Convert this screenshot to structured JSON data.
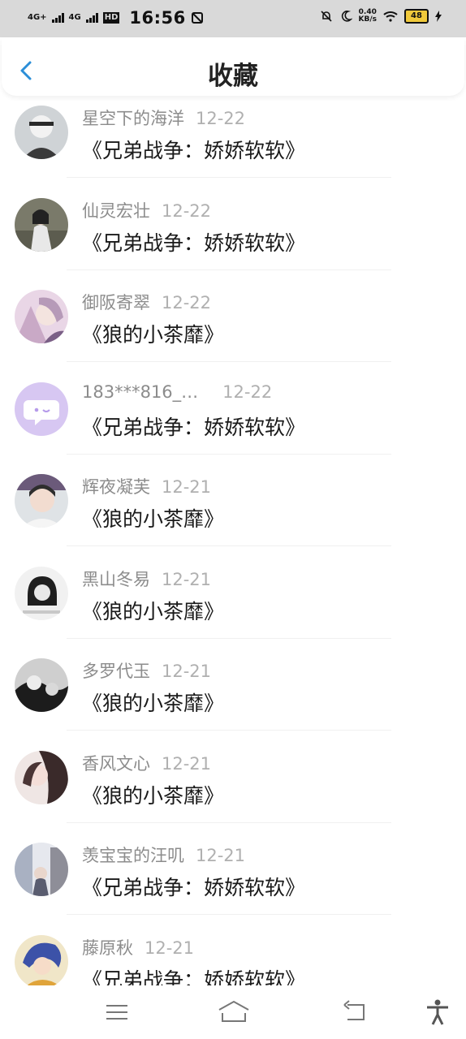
{
  "status_bar": {
    "network1": "4G+",
    "network2": "4G",
    "hd": "HD",
    "time": "16:56",
    "speed_value": "0.40",
    "speed_unit": "KB/s",
    "battery": "48"
  },
  "header": {
    "title": "收藏"
  },
  "items": [
    {
      "username": "星空下的海洋",
      "date": "12-22",
      "message": "《兄弟战争：娇娇软软》"
    },
    {
      "username": "仙灵宏壮",
      "date": "12-22",
      "message": "《兄弟战争：娇娇软软》"
    },
    {
      "username": "御阪寄翠",
      "date": "12-22",
      "message": "《狼的小茶靡》"
    },
    {
      "username": "183***816_…",
      "date": "12-22",
      "message": "《兄弟战争：娇娇软软》"
    },
    {
      "username": "辉夜凝芙",
      "date": "12-21",
      "message": "《狼的小茶靡》"
    },
    {
      "username": "黑山冬易",
      "date": "12-21",
      "message": "《狼的小茶靡》"
    },
    {
      "username": "多罗代玉",
      "date": "12-21",
      "message": "《狼的小茶靡》"
    },
    {
      "username": "香风文心",
      "date": "12-21",
      "message": "《狼的小茶靡》"
    },
    {
      "username": "羡宝宝的汪叽",
      "date": "12-21",
      "message": "《兄弟战争：娇娇软软》"
    },
    {
      "username": "藤原秋",
      "date": "12-21",
      "message": "《兄弟战争：娇娇软软》"
    }
  ],
  "colors": {
    "accent": "#2b8ed8",
    "username": "#8c8c8c",
    "date": "#b0b0b0",
    "message": "#1a1a1a"
  },
  "icons": {
    "back": "chevron-left-icon",
    "menu": "menu-icon",
    "home": "home-icon",
    "back_nav": "back-arrow-icon",
    "accessibility": "accessibility-icon"
  }
}
